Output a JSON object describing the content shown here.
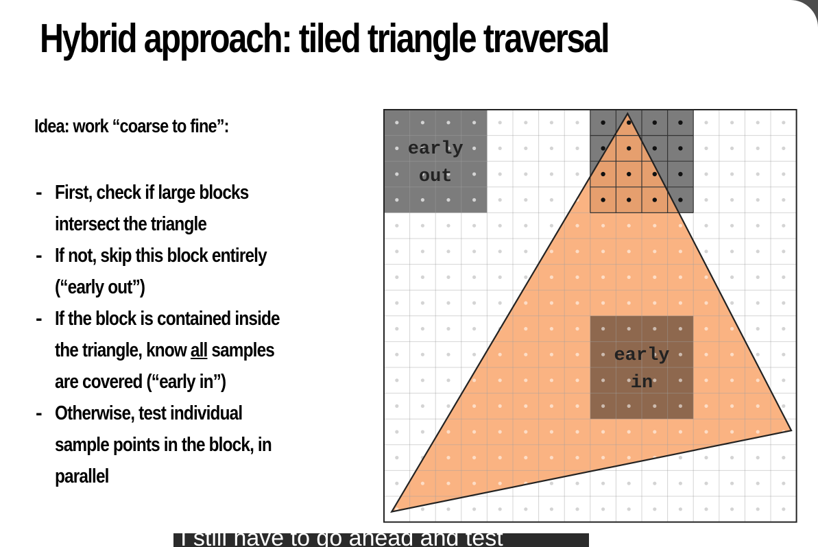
{
  "slide": {
    "title": "Hybrid approach: tiled triangle traversal"
  },
  "content": {
    "idea": "Idea: work “coarse to fine”:",
    "bullets": [
      {
        "lines": [
          "First, check if large blocks",
          "intersect the triangle"
        ]
      },
      {
        "lines": [
          "If not, skip this block entirely",
          "(“early out”)"
        ]
      },
      {
        "lines": [
          "If the block is contained inside"
        ],
        "line2_pre": "the triangle, know ",
        "line2_u": "all",
        "line2_post": " samples",
        "line3": "are covered (“early in”)"
      },
      {
        "lines": [
          "Otherwise, test individual",
          "sample points in the block, in",
          "parallel"
        ]
      }
    ]
  },
  "diagram": {
    "grid_columns": 16,
    "grid_rows": 16,
    "block_size": 4,
    "triangle_vertices_in_cells": [
      [
        9.45,
        0.15
      ],
      [
        15.8,
        12.45
      ],
      [
        0.3,
        15.6
      ]
    ],
    "early_out_label": [
      "early",
      "out"
    ],
    "early_in_label": [
      "early",
      "in"
    ],
    "early_out_block": [
      0,
      0
    ],
    "early_in_block": [
      2,
      2
    ],
    "edge_test_block": [
      2,
      0
    ],
    "colors": {
      "triangle_fill": "#f9a66c",
      "early_out_fill": "#7c7c7c",
      "edge_block_fill": "#7c7c7c",
      "early_in_fill": "#7a5a45",
      "grid_line": "#e2e2e2",
      "sample_dot": "#d4d4d4",
      "covered_dot": "#111111"
    }
  },
  "caption": {
    "text": "I still have to go ahead and test"
  }
}
